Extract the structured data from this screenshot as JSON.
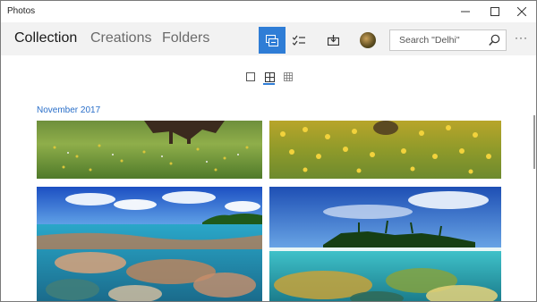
{
  "app": {
    "title": "Photos"
  },
  "nav": {
    "collection": "Collection",
    "creations": "Creations",
    "folders": "Folders"
  },
  "search": {
    "placeholder": "Search \"Delhi\""
  },
  "collection": {
    "month": "November 2017"
  },
  "toolbar": {
    "active": "select-items"
  },
  "colors": {
    "accent": "#2f7dd6",
    "month_heading": "#2a6fc9"
  }
}
